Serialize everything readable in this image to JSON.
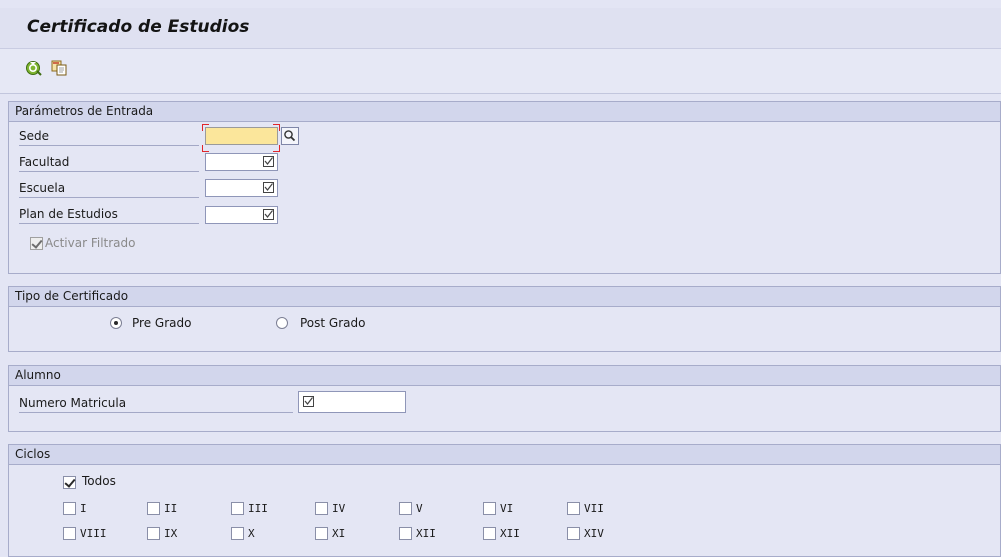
{
  "window": {
    "title": "Certificado de Estudios"
  },
  "toolbar": {
    "execute_icon": "execute-icon",
    "variant_icon": "get-variant-icon"
  },
  "params": {
    "header": "Parámetros de Entrada",
    "fields": [
      {
        "label": "Sede",
        "value": ""
      },
      {
        "label": "Facultad",
        "value": ""
      },
      {
        "label": "Escuela",
        "value": ""
      },
      {
        "label": "Plan de Estudios",
        "value": ""
      }
    ],
    "filter_checkbox": {
      "label": "Activar Filtrado",
      "checked": true,
      "enabled": false
    }
  },
  "cert_type": {
    "header": "Tipo de Certificado",
    "options": [
      {
        "label": "Pre Grado",
        "selected": true
      },
      {
        "label": "Post Grado",
        "selected": false
      }
    ]
  },
  "student": {
    "header": "Alumno",
    "label": "Numero Matricula",
    "value": ""
  },
  "cycles": {
    "header": "Ciclos",
    "all": {
      "label": "Todos",
      "checked": true
    },
    "row1": [
      "I",
      "II",
      "III",
      "IV",
      "V",
      "VI",
      "VII"
    ],
    "row2": [
      "VIII",
      "IX",
      "X",
      "XI",
      "XII",
      "XII",
      "XIV"
    ]
  },
  "colors": {
    "background": "#e3e5f4",
    "group_header": "#d2d6ec",
    "focus_field": "#fbe69b",
    "focus_corner": "#e0262b"
  }
}
